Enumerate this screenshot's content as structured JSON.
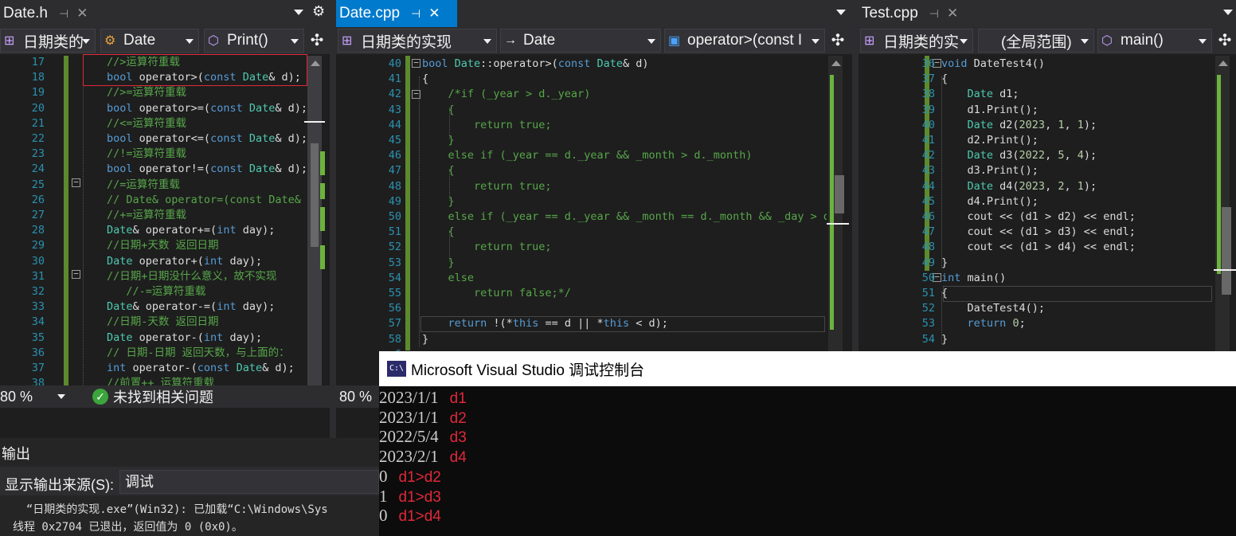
{
  "pane1": {
    "tab_title": "Date.h",
    "nav": {
      "project": "日期类的",
      "class": "Date",
      "member": "Print()"
    },
    "zoom": "80 %",
    "issues": "未找到相关问题",
    "lines": [
      {
        "n": "17",
        "t": "//>运算符重载"
      },
      {
        "n": "18",
        "t": "bool operator>(const Date& d);"
      },
      {
        "n": "19",
        "t": "//>=运算符重载"
      },
      {
        "n": "20",
        "t": "bool operator>=(const Date& d);"
      },
      {
        "n": "21",
        "t": "//<=运算符重载"
      },
      {
        "n": "22",
        "t": "bool operator<=(const Date& d);"
      },
      {
        "n": "23",
        "t": "//!=运算符重载"
      },
      {
        "n": "24",
        "t": "bool operator!=(const Date& d);"
      },
      {
        "n": "25",
        "t": "//=运算符重载"
      },
      {
        "n": "26",
        "t": "// Date& operator=(const Date& d"
      },
      {
        "n": "27",
        "t": "//+=运算符重载"
      },
      {
        "n": "28",
        "t": "Date& operator+=(int day);"
      },
      {
        "n": "29",
        "t": "//日期+天数 返回日期"
      },
      {
        "n": "30",
        "t": "Date operator+(int day);"
      },
      {
        "n": "31",
        "t": "//日期+日期没什么意义，故不实现"
      },
      {
        "n": "32",
        "t": "   //-=运算符重载"
      },
      {
        "n": "33",
        "t": "Date& operator-=(int day);"
      },
      {
        "n": "34",
        "t": "//日期-天数 返回日期"
      },
      {
        "n": "35",
        "t": "Date operator-(int day);"
      },
      {
        "n": "36",
        "t": "// 日期-日期 返回天数，与上面的："
      },
      {
        "n": "37",
        "t": "int operator-(const Date& d);"
      },
      {
        "n": "38",
        "t": "//前置++ 运算符重载"
      },
      {
        "n": "39",
        "t": "Date& operator++();"
      }
    ]
  },
  "pane2": {
    "tab_title": "Date.cpp",
    "nav": {
      "project": "日期类的实现",
      "class": "Date",
      "member": "operator>(const I"
    },
    "zoom": "80 %",
    "lines": [
      {
        "n": "40",
        "t": "bool Date::operator>(const Date& d)"
      },
      {
        "n": "41",
        "t": "{"
      },
      {
        "n": "42",
        "t": "    /*if (_year > d._year)"
      },
      {
        "n": "43",
        "t": "    {"
      },
      {
        "n": "44",
        "t": "        return true;"
      },
      {
        "n": "45",
        "t": "    }"
      },
      {
        "n": "46",
        "t": "    else if (_year == d._year && _month > d._month)"
      },
      {
        "n": "47",
        "t": "    {"
      },
      {
        "n": "48",
        "t": "        return true;"
      },
      {
        "n": "49",
        "t": "    }"
      },
      {
        "n": "50",
        "t": "    else if (_year == d._year && _month == d._month && _day > d._"
      },
      {
        "n": "51",
        "t": "    {"
      },
      {
        "n": "52",
        "t": "        return true;"
      },
      {
        "n": "53",
        "t": "    }"
      },
      {
        "n": "54",
        "t": "    else"
      },
      {
        "n": "55",
        "t": "        return false;*/"
      },
      {
        "n": "56",
        "t": ""
      },
      {
        "n": "57",
        "t": "    return !(*this == d || *this < d);"
      },
      {
        "n": "58",
        "t": "}"
      }
    ],
    "hidden_line_numbers": [
      "6",
      "6"
    ]
  },
  "pane3": {
    "tab_title": "Test.cpp",
    "nav": {
      "project": "日期类的实",
      "scope": "(全局范围)",
      "member": "main()"
    },
    "lines": [
      {
        "n": "36",
        "t": "void DateTest4()"
      },
      {
        "n": "37",
        "t": "{"
      },
      {
        "n": "38",
        "t": "    Date d1;"
      },
      {
        "n": "39",
        "t": "    d1.Print();"
      },
      {
        "n": "40",
        "t": "    Date d2(2023, 1, 1);"
      },
      {
        "n": "41",
        "t": "    d2.Print();"
      },
      {
        "n": "42",
        "t": "    Date d3(2022, 5, 4);"
      },
      {
        "n": "43",
        "t": "    d3.Print();"
      },
      {
        "n": "44",
        "t": "    Date d4(2023, 2, 1);"
      },
      {
        "n": "45",
        "t": "    d4.Print();"
      },
      {
        "n": "46",
        "t": "    cout << (d1 > d2) << endl;"
      },
      {
        "n": "47",
        "t": "    cout << (d1 > d3) << endl;"
      },
      {
        "n": "48",
        "t": "    cout << (d1 > d4) << endl;"
      },
      {
        "n": "49",
        "t": "}"
      },
      {
        "n": "50",
        "t": "int main()"
      },
      {
        "n": "51",
        "t": "{"
      },
      {
        "n": "52",
        "t": "    DateTest4();"
      },
      {
        "n": "53",
        "t": "    return 0;"
      },
      {
        "n": "54",
        "t": "}"
      }
    ]
  },
  "output": {
    "title": "输出",
    "source_label": "显示输出来源(S):",
    "source_value": "调试",
    "lines": [
      "  “日期类的实现.exe”(Win32): 已加载“C:\\Windows\\Sys",
      "线程 0x2704 已退出，返回值为 0 (0x0)。",
      "“日期类的实现.exe”(Win32): 已加载“C:\\Windows\\Sys"
    ]
  },
  "console": {
    "title": "Microsoft Visual Studio 调试控制台",
    "icon": "C:\\",
    "lines": [
      {
        "text": "2023/1/1",
        "label": "d1"
      },
      {
        "text": "2023/1/1",
        "label": "d2"
      },
      {
        "text": "2022/5/4",
        "label": "d3"
      },
      {
        "text": "2023/2/1",
        "label": "d4"
      },
      {
        "text": "0",
        "label": "d1>d2"
      },
      {
        "text": "1",
        "label": "d1>d3"
      },
      {
        "text": "0",
        "label": "d1>d4"
      }
    ]
  },
  "colors": {
    "accent": "#007acc",
    "annotation_red": "#e0283a",
    "comment_green": "#57a64a",
    "keyword_blue": "#569cd6"
  }
}
